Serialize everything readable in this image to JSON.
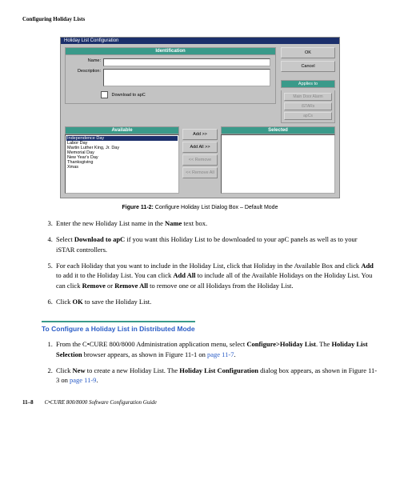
{
  "header": "Configuring Holiday Lists",
  "dialog": {
    "title": "Holiday List Configuration",
    "identification_head": "Identification",
    "name_label": "Name:",
    "desc_label": "Description:",
    "download_label": "Download to apC",
    "ok": "OK",
    "cancel": "Cancel",
    "applies_head": "Applies to",
    "applies": {
      "a": "Main Door Alarm",
      "b": "iSTARs",
      "c": "apCs"
    },
    "available_head": "Available",
    "selected_head": "Selected",
    "available": {
      "i0": "Independence Day",
      "i1": "Labor Day",
      "i2": "Martin Luther King, Jr. Day",
      "i3": "Memorial Day",
      "i4": "New Year's Day",
      "i5": "Thanksgiving",
      "i6": "Xmas"
    },
    "btns": {
      "add": "Add >>",
      "addall": "Add All >>",
      "rem": "<< Remove",
      "remall": "<< Remove All"
    }
  },
  "figure_caption_bold": "Figure 11-2:",
  "figure_caption": "Configure Holiday List Dialog Box – Default Mode",
  "steps3_6": {
    "s3": "Enter the new Holiday List name in the <b>Name</b> text box.",
    "s4": "Select <b>Download to apC</b> if you want this Holiday List to be downloaded to your apC panels as well as to your iSTAR controllers.",
    "s5": "For each Holiday that you want to include in the Holiday List, click that Holiday in the Available Box and click <b>Add</b> to add it to the Holiday List. You can click <b>Add All</b> to include all of the Available Holidays on the Holiday List. You can click <b>Remove</b> or <b>Remove All</b> to remove one or all Holidays from the Holiday List.",
    "s6": "Click <b>OK</b> to save the Holiday List."
  },
  "subheading": "To Configure a Holiday List in Distributed Mode",
  "steps1_2": {
    "s1": "From the C•CURE 800/8000 Administration application menu, select <b>Configure&gt;Holiday List</b>. The <b>Holiday List Selection</b> browser appears, as shown in Figure 11-1 on <span class='link'>page 11-7</span>.",
    "s2": "Click <b>New</b> to create a new Holiday List. The <b>Holiday List Configuration</b> dialog box appears, as shown in Figure 11-3 on <span class='link'>page 11-9</span>."
  },
  "footer": {
    "pagenum": "11–8",
    "title": "C•CURE 800/8000 Software Configuration Guide"
  }
}
